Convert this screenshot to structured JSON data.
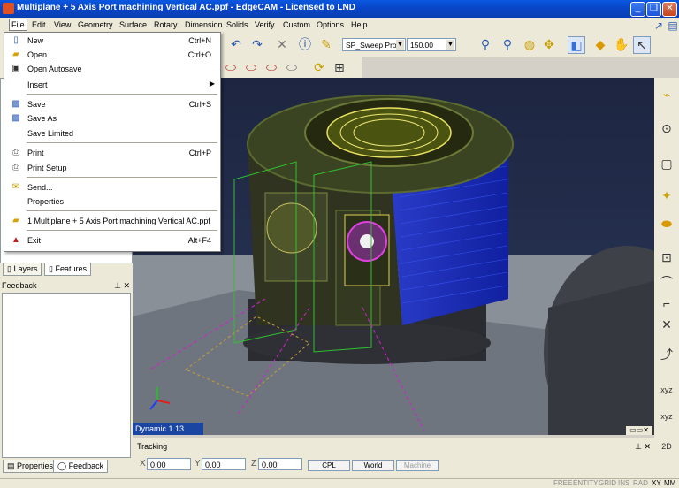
{
  "window": {
    "title": "Multiplane + 5 Axis Port machining Vertical AC.ppf - EdgeCAM - Licensed to LND"
  },
  "menubar": [
    "File",
    "Edit",
    "View",
    "Geometry",
    "Surface",
    "Rotary",
    "Dimension",
    "Solids",
    "Verify",
    "Custom",
    "Options",
    "Help"
  ],
  "toolbar": {
    "style_combo": "SP_Sweep Prof",
    "value_combo": "150.00"
  },
  "file_menu": {
    "new": {
      "label": "New",
      "shortcut": "Ctrl+N"
    },
    "open": {
      "label": "Open...",
      "shortcut": "Ctrl+O"
    },
    "open_autosave": {
      "label": "Open Autosave"
    },
    "insert": {
      "label": "Insert"
    },
    "save": {
      "label": "Save",
      "shortcut": "Ctrl+S"
    },
    "save_as": {
      "label": "Save As"
    },
    "save_limited": {
      "label": "Save Limited"
    },
    "print": {
      "label": "Print",
      "shortcut": "Ctrl+P"
    },
    "print_setup": {
      "label": "Print Setup"
    },
    "send": {
      "label": "Send..."
    },
    "properties": {
      "label": "Properties"
    },
    "recent1": {
      "label": "1 Multiplane + 5 Axis Port machining Vertical AC.ppf"
    },
    "exit": {
      "label": "Exit",
      "shortcut": "Alt+F4"
    }
  },
  "left_panel": {
    "tabs": [
      "Layers",
      "Features"
    ],
    "feedback_title": "Feedback",
    "bottom_tabs": [
      "Properties",
      "Feedback"
    ]
  },
  "viewport": {
    "view_label": "Dynamic 1.13"
  },
  "tracking": {
    "title": "Tracking",
    "x_label": "X",
    "x_value": "0.00",
    "y_label": "Y",
    "y_value": "0.00",
    "z_label": "Z",
    "z_value": "0.00",
    "cpl": "CPL",
    "world": "World",
    "machine": "Machine"
  },
  "status": [
    "FREE",
    "ENTITY",
    "GRID",
    "INS",
    "RAD",
    "XY",
    "MM"
  ]
}
